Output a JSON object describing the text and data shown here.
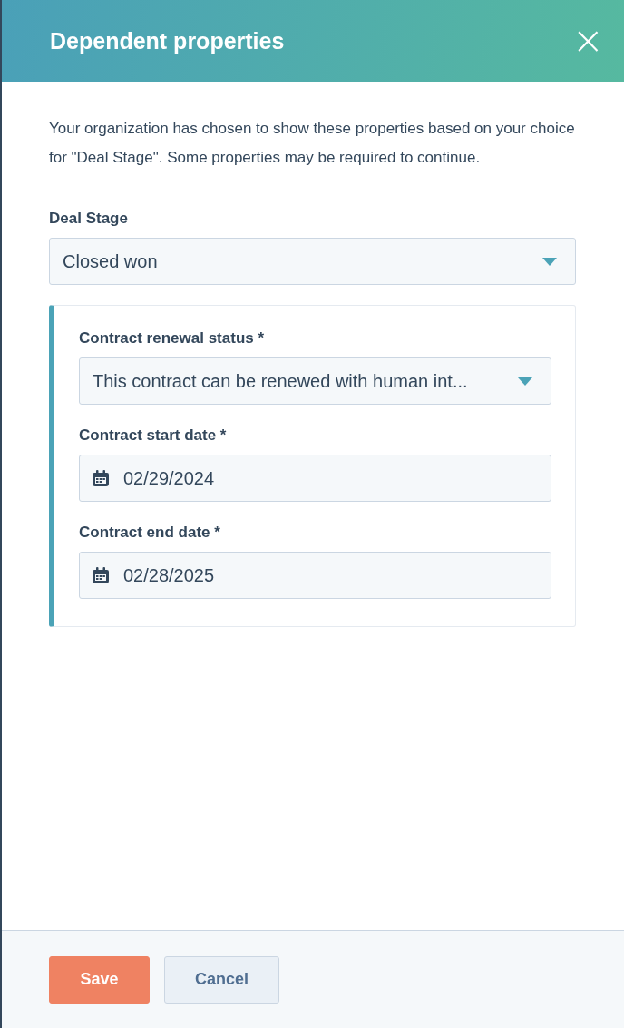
{
  "dialog": {
    "title": "Dependent properties",
    "close": "×"
  },
  "intro": "Your organization has chosen to show these properties based on your choice for \"Deal Stage\". Some properties may be required to continue.",
  "deal_stage": {
    "label": "Deal Stage",
    "value": "Closed won"
  },
  "dependent_fields": [
    {
      "kind": "select",
      "label": "Contract renewal status *",
      "value": "This contract can be renewed with human int..."
    },
    {
      "kind": "date",
      "label": "Contract start date *",
      "value": "02/29/2024"
    },
    {
      "kind": "date",
      "label": "Contract end date *",
      "value": "02/28/2025"
    }
  ],
  "buttons": [
    {
      "kind": "primary",
      "label": "Save"
    },
    {
      "kind": "secondary",
      "label": "Cancel"
    }
  ]
}
